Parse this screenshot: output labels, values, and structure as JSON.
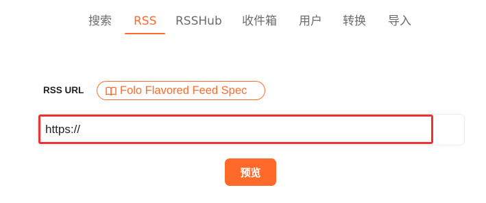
{
  "tabs": [
    {
      "label": "搜索",
      "active": false
    },
    {
      "label": "RSS",
      "active": true
    },
    {
      "label": "RSSHub",
      "active": false
    },
    {
      "label": "收件箱",
      "active": false
    },
    {
      "label": "用户",
      "active": false
    },
    {
      "label": "转换",
      "active": false
    },
    {
      "label": "导入",
      "active": false
    }
  ],
  "form": {
    "field_label": "RSS URL",
    "spec_link": {
      "icon": "book-open-icon",
      "label": "Folo Flavored Feed Spec"
    },
    "url_input": {
      "value": "https://"
    },
    "preview_button_label": "预览"
  },
  "colors": {
    "accent": "#ff6a2b",
    "highlight_border": "#ee3030",
    "tab_inactive": "#6b6b6b"
  }
}
